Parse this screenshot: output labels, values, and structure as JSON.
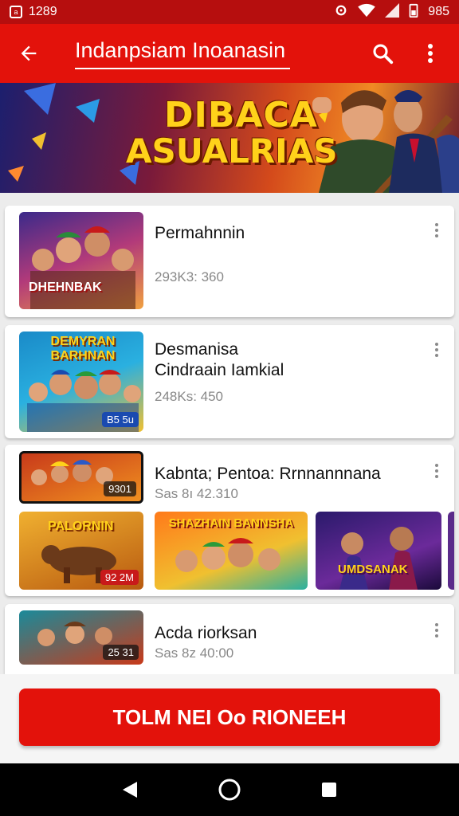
{
  "status_bar": {
    "time": "1289",
    "battery": "985"
  },
  "app_bar": {
    "title": "Indanpsiam Inoanasin",
    "icons": [
      "back-arrow-icon",
      "search-icon",
      "more-vert-icon"
    ]
  },
  "banner": {
    "line1": "DIBACA",
    "line2": "ASUALRIAS"
  },
  "items": [
    {
      "title": "Permahnnin",
      "meta": "293K3: 360",
      "thumb_text": "DHEHNBAK"
    },
    {
      "title": "Desmanisa",
      "title2": "Cindraain Iamkial",
      "meta": "248Ks: 450",
      "thumb_text": "DEMYRAN BARHNAN",
      "badge": "B5 5u"
    },
    {
      "title": "Kabnta; Pentoa: Rrnnannnana",
      "meta": "Sas 8ı 42.310",
      "thumb_badge": "9301",
      "subthumbs": [
        {
          "text": "PALORNIN",
          "badge": "92 2M"
        },
        {
          "text": "SHAZHAIN BANNSHA"
        },
        {
          "text": "UMDSANAK"
        }
      ]
    },
    {
      "title": "Acda riorksan",
      "meta": "Sas 8z 40:00",
      "badge": "25 31"
    }
  ],
  "cta": {
    "label": "TOLM NEI Oo RIONEEH"
  },
  "colors": {
    "primary": "#e3120b",
    "status": "#b60e0e"
  }
}
